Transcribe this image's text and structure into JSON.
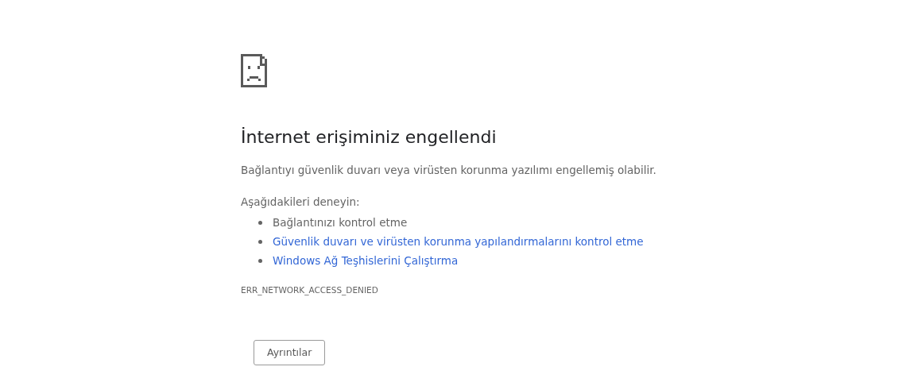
{
  "title": "İnternet erişiminiz engellendi",
  "message": "Bağlantıyı güvenlik duvarı veya virüsten korunma yazılımı engellemiş olabilir.",
  "suggestions_heading": "Aşağıdakileri deneyin:",
  "suggestions": [
    {
      "kind": "text",
      "label": "Bağlantınızı kontrol etme"
    },
    {
      "kind": "link",
      "label": "Güvenlik duvarı ve virüsten korunma yapılandırmalarını kontrol etme"
    },
    {
      "kind": "link",
      "label": "Windows Ağ Teşhislerini Çalıştırma"
    }
  ],
  "error_code": "ERR_NETWORK_ACCESS_DENIED",
  "details_button": "Ayrıntılar"
}
